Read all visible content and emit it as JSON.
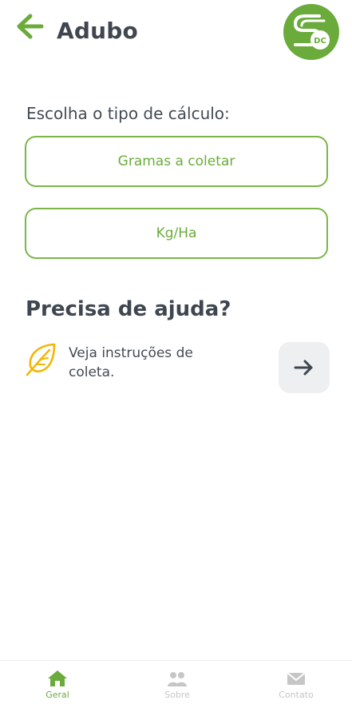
{
  "header": {
    "title": "Adubo",
    "logo_text": "DC"
  },
  "calc": {
    "prompt": "Escolha o tipo de cálculo:",
    "options": [
      {
        "label": "Gramas a coletar"
      },
      {
        "label": "Kg/Ha"
      }
    ]
  },
  "help": {
    "title": "Precisa de ajuda?",
    "text": "Veja instruções de coleta."
  },
  "nav": {
    "items": [
      {
        "label": "Geral",
        "icon": "home-icon",
        "active": true
      },
      {
        "label": "Sobre",
        "icon": "people-icon",
        "active": false
      },
      {
        "label": "Contato",
        "icon": "mail-icon",
        "active": false
      }
    ]
  },
  "colors": {
    "accent": "#6aab3b",
    "title": "#3f4650",
    "inactive": "#c6c6c6",
    "leaf": "#f2b705"
  }
}
